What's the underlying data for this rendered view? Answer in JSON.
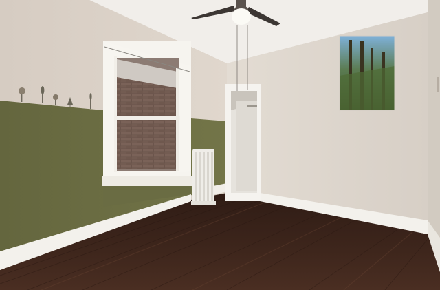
{
  "scene": {
    "subject": "empty bedroom",
    "colors": {
      "wall_upper": "#ddd3c9",
      "wall_right": "#e2dbd2",
      "wall_green": "#6d6f45",
      "ceiling": "#f1eeea",
      "floor": "#3e261c",
      "trim": "#f3f1ec",
      "brick": "#6d5850"
    },
    "objects": [
      "ceiling-fan",
      "window",
      "brick-wall-view",
      "radiator",
      "doorway",
      "forest-wall-art",
      "tree-decals",
      "hardwood-floor",
      "baseboards"
    ]
  }
}
